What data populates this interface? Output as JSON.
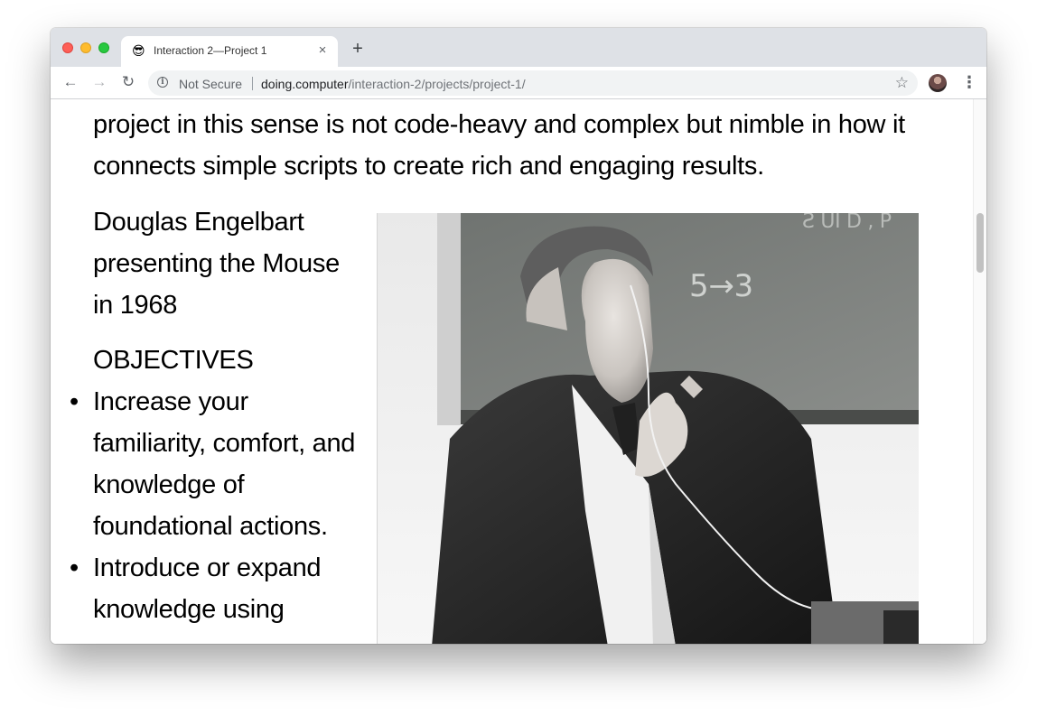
{
  "browser": {
    "tab": {
      "favicon": "😎",
      "title": "Interaction 2—Project 1",
      "close_glyph": "×"
    },
    "new_tab_glyph": "+",
    "nav": {
      "back_glyph": "←",
      "forward_glyph": "→",
      "reload_glyph": "↻"
    },
    "omnibox": {
      "security_label": "Not Secure",
      "info_glyph": "i",
      "url_host": "doing.computer",
      "url_path": "/interaction-2/projects/project-1/",
      "star_glyph": "☆"
    },
    "menu_glyph": "⋮"
  },
  "page": {
    "intro_text": "project in this sense is not code-heavy and complex but nimble in how it connects simple scripts to create rich and engaging results.",
    "caption": "Douglas Engelbart presenting the Mouse in 1968",
    "objectives_heading": "OBJECTIVES",
    "objectives": [
      "Increase your familiarity, comfort, and knowledge of foundational actions.",
      "Introduce or expand knowledge using"
    ],
    "bullet_glyph": "•"
  },
  "icons": {
    "info": "info-circle-icon",
    "star": "bookmark-star-icon",
    "menu": "kebab-menu-icon",
    "avatar": "profile-avatar"
  },
  "colors": {
    "tabstrip": "#dee1e6",
    "omnibox": "#f1f3f4",
    "close": "#fe5f57",
    "minimize": "#febc2e",
    "maximize": "#28c840"
  }
}
